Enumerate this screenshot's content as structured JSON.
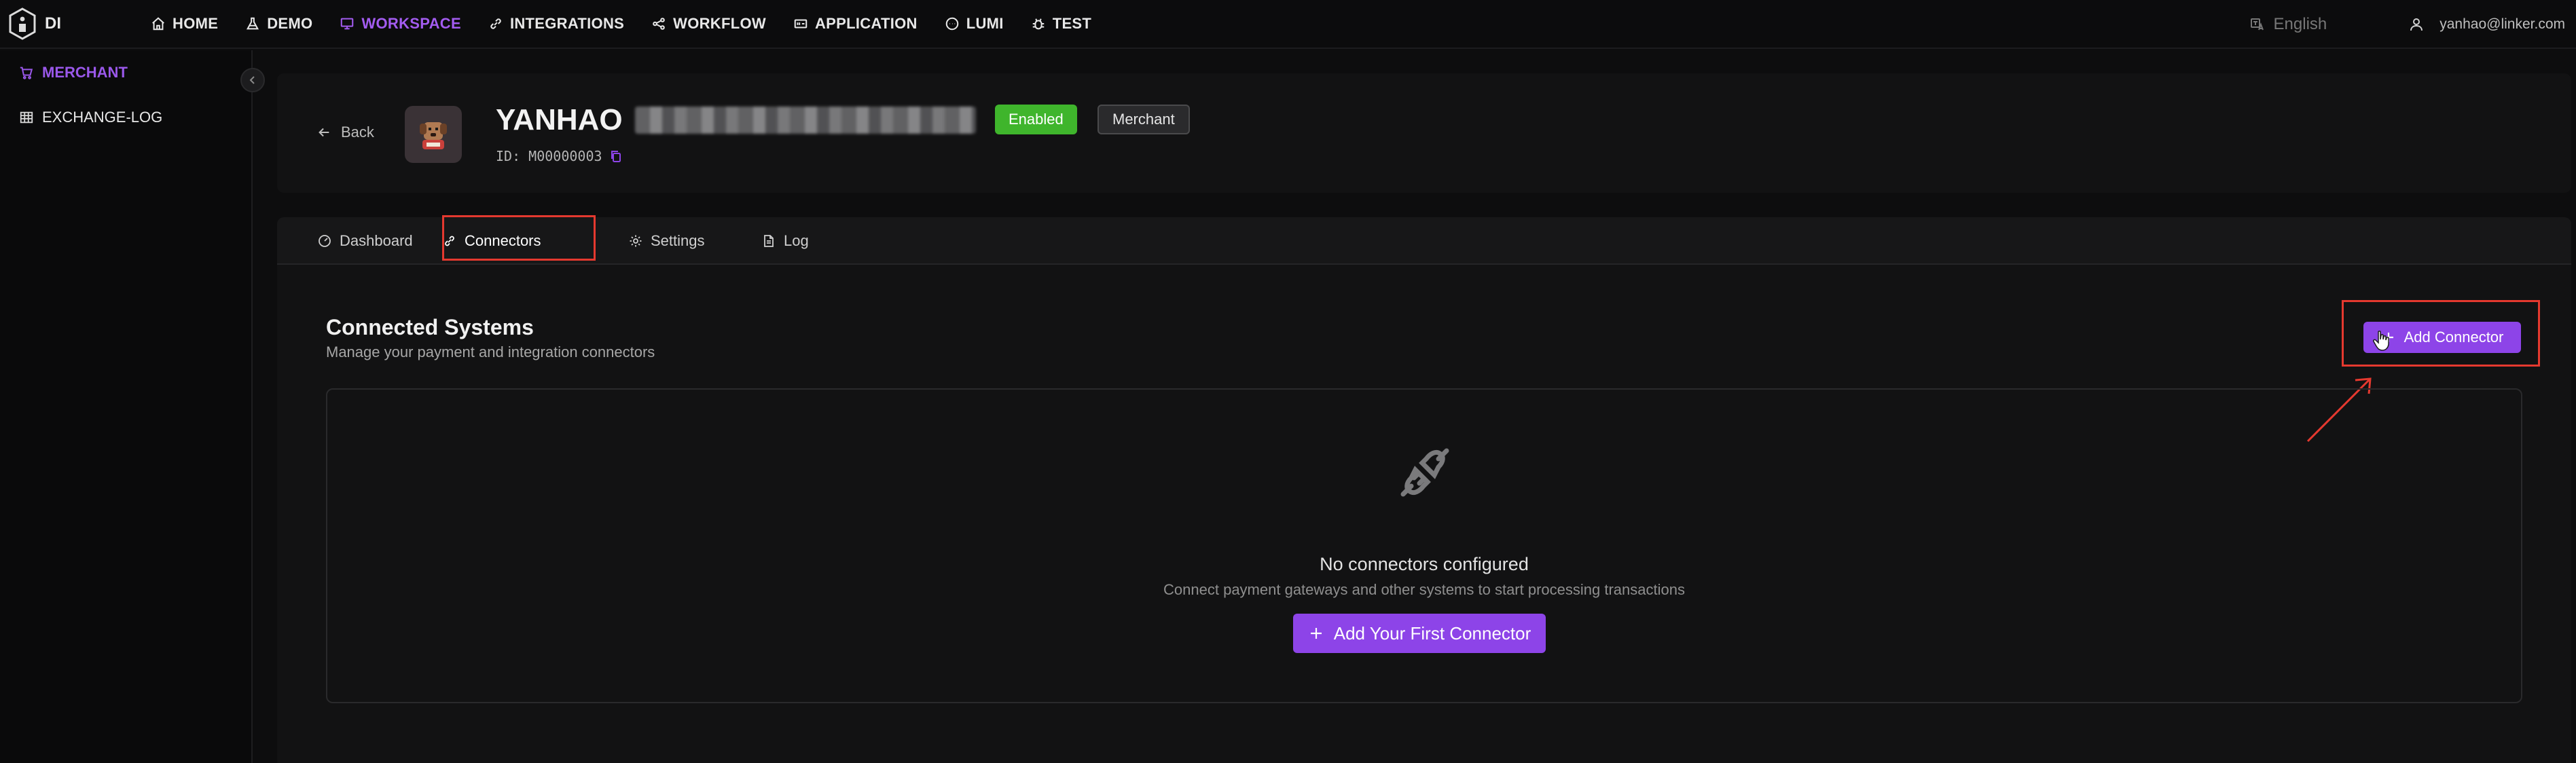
{
  "brand": {
    "name": "DI"
  },
  "nav": {
    "items": [
      {
        "label": "HOME",
        "icon": "home-icon"
      },
      {
        "label": "DEMO",
        "icon": "flask-icon"
      },
      {
        "label": "WORKSPACE",
        "icon": "monitor-icon",
        "active": true
      },
      {
        "label": "INTEGRATIONS",
        "icon": "link-icon"
      },
      {
        "label": "WORKFLOW",
        "icon": "share-nodes-icon"
      },
      {
        "label": "APPLICATION",
        "icon": "app-window-icon"
      },
      {
        "label": "LUMI",
        "icon": "chat-bubble-icon"
      },
      {
        "label": "TEST",
        "icon": "bug-icon"
      }
    ],
    "language": "English",
    "user_email": "yanhao@linker.com"
  },
  "sidebar": {
    "items": [
      {
        "label": "MERCHANT",
        "icon": "cart-icon",
        "active": true
      },
      {
        "label": "EXCHANGE-LOG",
        "icon": "table-icon",
        "active": false
      }
    ]
  },
  "merchant": {
    "back_label": "Back",
    "name": "YANHAO",
    "status": "Enabled",
    "type": "Merchant",
    "id_label": "ID: M00000003"
  },
  "tabs": [
    {
      "label": "Dashboard",
      "icon": "gauge-icon"
    },
    {
      "label": "Connectors",
      "icon": "link-icon",
      "active": true
    },
    {
      "label": "Settings",
      "icon": "gear-icon"
    },
    {
      "label": "Log",
      "icon": "document-icon"
    }
  ],
  "connectors": {
    "title": "Connected Systems",
    "subtitle": "Manage your payment and integration connectors",
    "add_button": "Add Connector",
    "empty_title": "No connectors configured",
    "empty_subtitle": "Connect payment gateways and other systems to start processing transactions",
    "first_button": "Add Your First Connector"
  },
  "colors": {
    "accent": "#8d44e8",
    "nav_active": "#a35cf0",
    "status_enabled": "#3fb52c",
    "annotation": "#e5392f"
  }
}
